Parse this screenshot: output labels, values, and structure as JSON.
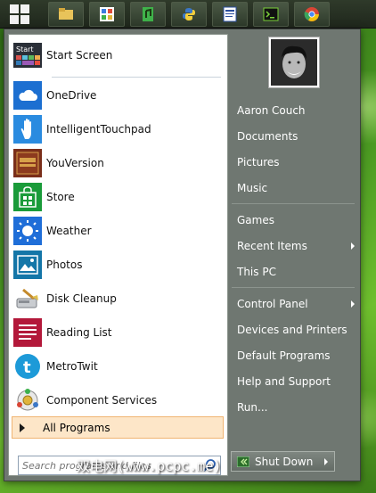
{
  "taskbar": {
    "apps": [
      {
        "icon": "file-explorer-icon",
        "color": "#e8c35a"
      },
      {
        "icon": "apps-grid-icon",
        "color": "#ffffff"
      },
      {
        "icon": "media-app-icon",
        "color": "#3fb24a"
      },
      {
        "icon": "python-icon",
        "color": "#3b77c7"
      },
      {
        "icon": "document-app-icon",
        "color": "#2b4f9f"
      },
      {
        "icon": "terminal-icon",
        "color": "#2f3b2a"
      },
      {
        "icon": "chrome-icon",
        "color": "#d94535"
      }
    ]
  },
  "left_pane": {
    "pinned": {
      "label": "Start Screen",
      "icon_text": "Start"
    },
    "programs": [
      {
        "label": "OneDrive",
        "icon": "onedrive-icon",
        "bg": "#1c6fd1"
      },
      {
        "label": "IntelligentTouchpad",
        "icon": "touchpad-hand-icon",
        "bg": "#2a8be0"
      },
      {
        "label": "YouVersion",
        "icon": "bible-icon",
        "bg": "#7a2e1a"
      },
      {
        "label": "Store",
        "icon": "store-bag-icon",
        "bg": "#1a9b3a"
      },
      {
        "label": "Weather",
        "icon": "weather-sun-icon",
        "bg": "#1f6ed8"
      },
      {
        "label": "Photos",
        "icon": "photos-icon",
        "bg": "#1476a8"
      },
      {
        "label": "Disk Cleanup",
        "icon": "disk-cleanup-icon",
        "bg": "#ffffff"
      },
      {
        "label": "Reading List",
        "icon": "reading-list-icon",
        "bg": "#b3183a"
      },
      {
        "label": "MetroTwit",
        "icon": "metrotwit-icon",
        "bg": "#1d9ad8"
      },
      {
        "label": "Component Services",
        "icon": "component-services-icon",
        "bg": "#ffffff"
      }
    ],
    "all_programs_label": "All Programs",
    "search_placeholder": "Search programs and files"
  },
  "right_pane": {
    "user_name": "Aaron Couch",
    "links_group1": [
      "Documents",
      "Pictures",
      "Music"
    ],
    "links_group2": [
      {
        "label": "Games",
        "submenu": false
      },
      {
        "label": "Recent Items",
        "submenu": true
      },
      {
        "label": "This PC",
        "submenu": false
      }
    ],
    "links_group3": [
      {
        "label": "Control Panel",
        "submenu": true
      },
      {
        "label": "Devices and Printers",
        "submenu": false
      },
      {
        "label": "Default Programs",
        "submenu": false
      },
      {
        "label": "Help and Support",
        "submenu": false
      },
      {
        "label": "Run...",
        "submenu": false
      }
    ],
    "shutdown_label": "Shut Down"
  },
  "watermark": "双电网(www.pcpc.me)"
}
